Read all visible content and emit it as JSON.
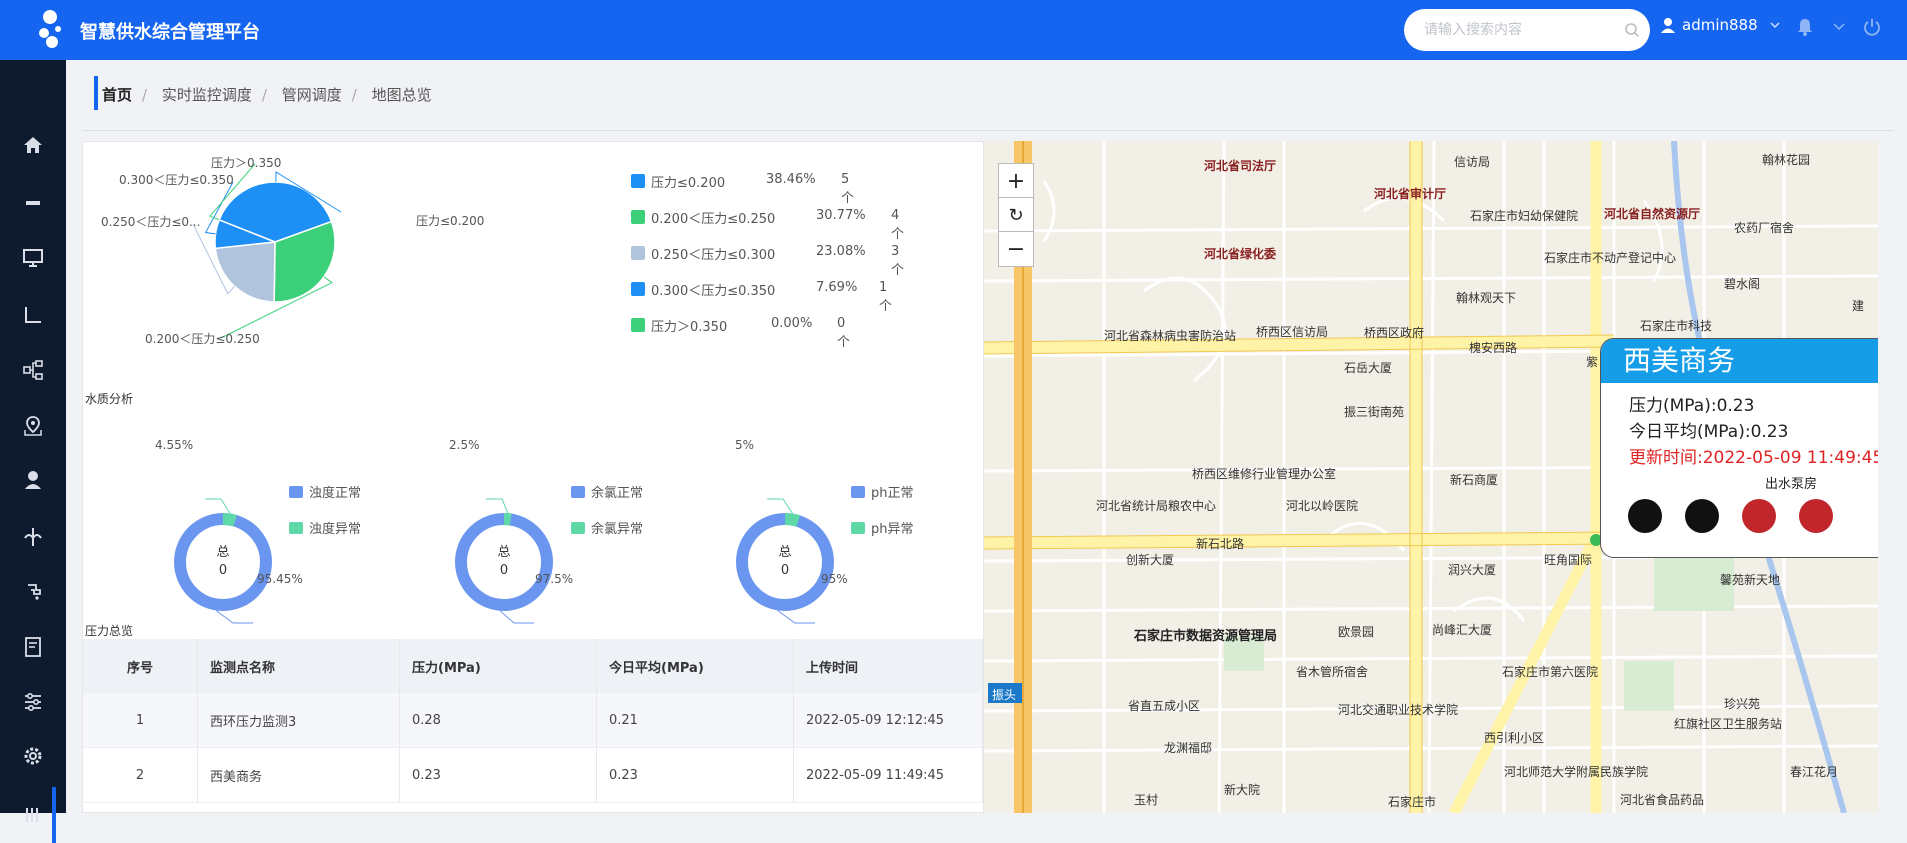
{
  "header": {
    "title": "智慧供水综合管理平台",
    "search_placeholder": "请输入搜索内容",
    "username": "admin888"
  },
  "sidebar": {
    "items": [
      "home-icon",
      "minus-icon",
      "monitor-icon",
      "corner-icon",
      "flow-chart-icon",
      "map-pin-icon",
      "user-service-icon",
      "network-icon",
      "tap-icon",
      "report-icon",
      "sliders-icon",
      "gear-icon",
      "menu-icon"
    ]
  },
  "breadcrumb": [
    "首页",
    "实时监控调度",
    "管网调度",
    "地图总览"
  ],
  "pressure_pie": {
    "chart_data": {
      "type": "pie",
      "categories": [
        "压力≤0.200",
        "0.200＜压力≤0.250",
        "0.250＜压力≤0.300",
        "0.300＜压力≤0.350",
        "压力＞0.350"
      ],
      "values": [
        38.46,
        30.77,
        23.08,
        7.69,
        0.0
      ],
      "counts": [
        5,
        4,
        3,
        1,
        0
      ],
      "colors": [
        "#1e90f5",
        "#3dd07a",
        "#b0c4de",
        "#1e90f5",
        "#3dd07a"
      ]
    },
    "slice_labels": [
      "压力≤0.200",
      "0.200＜压力≤0.250",
      "0.250＜压力≤0...",
      "0.300＜压力≤0.350",
      "压力＞0.350"
    ],
    "legend": [
      {
        "label": "压力≤0.200",
        "pct": "38.46%",
        "count": "5个",
        "color": "#1e90f5"
      },
      {
        "label": "0.200＜压力≤0.250",
        "pct": "30.77%",
        "count": "4个",
        "color": "#3dd07a"
      },
      {
        "label": "0.250＜压力≤0.300",
        "pct": "23.08%",
        "count": "3个",
        "color": "#b0c4de"
      },
      {
        "label": "0.300＜压力≤0.350",
        "pct": "7.69%",
        "count": "1个",
        "color": "#1e90f5"
      },
      {
        "label": "压力＞0.350",
        "pct": "0.00%",
        "count": "0个",
        "color": "#3dd07a"
      }
    ]
  },
  "water_quality": {
    "title": "水质分析",
    "center_top": "总",
    "center_value": "0",
    "donuts": [
      {
        "normal": "浊度正常",
        "abnormal": "浊度异常",
        "normal_pct": 95.45,
        "abnormal_pct": 4.55,
        "normal_label": "95.45%",
        "abnormal_label": "4.55%"
      },
      {
        "normal": "余氯正常",
        "abnormal": "余氯异常",
        "normal_pct": 97.5,
        "abnormal_pct": 2.5,
        "normal_label": "97.5%",
        "abnormal_label": "2.5%"
      },
      {
        "normal": "ph正常",
        "abnormal": "ph异常",
        "normal_pct": 95,
        "abnormal_pct": 5,
        "normal_label": "95%",
        "abnormal_label": "5%"
      }
    ],
    "colors": {
      "normal": "#6b96f0",
      "abnormal": "#5fd8a8"
    }
  },
  "pressure_overview": {
    "title": "压力总览",
    "columns": [
      "序号",
      "监测点名称",
      "压力(MPa)",
      "今日平均(MPa)",
      "上传时间"
    ],
    "rows": [
      [
        "1",
        "西环压力监测3",
        "0.28",
        "0.21",
        "2022-05-09 12:12:45"
      ],
      [
        "2",
        "西美商务",
        "0.23",
        "0.23",
        "2022-05-09 11:49:45"
      ]
    ]
  },
  "map": {
    "controls": {
      "zoom_in": "+",
      "reset": "↻",
      "zoom_out": "−"
    },
    "popup": {
      "title": "西美商务",
      "pressure": "压力(MPa):0.23",
      "avg": "今日平均(MPa):0.23",
      "updated": "更新时间:2022-05-09 11:49:45",
      "pump_label": "出水泵房",
      "pumps": [
        "#111111",
        "#111111",
        "#c0262b",
        "#c0262b"
      ]
    },
    "labels": [
      "信访局",
      "河北省司法厅",
      "河北省审计厅",
      "石家庄市妇幼保健院",
      "河北省自然资源厅",
      "河北省绿化委",
      "石家庄市不动产登记中心",
      "翰林观天下",
      "碧水阁",
      "河北省森林病虫害防治站",
      "桥西区信访局",
      "桥西区政府",
      "槐安西路",
      "石家庄市科技",
      "石岳大厦",
      "紫",
      "振三街南苑",
      "新石商厦",
      "桥西区维修行业管理办公室",
      "河北省统计局粮农中心",
      "河北以岭医院",
      "新石北路",
      "创新大厦",
      "润兴大厦",
      "旺角国际",
      "石家庄市数据资源管理局",
      "欧景园",
      "尚峰汇大厦",
      "省木管所宿舍",
      "石家庄市第六医院",
      "省直五成小区",
      "河北交通职业技术学院",
      "龙渊福邸",
      "西引利小区",
      "红旗社区卫生服务站",
      "珍兴苑",
      "振头",
      "河北师范大学附属民族学院",
      "新大院",
      "玉村",
      "石家庄市",
      "河北省食品药品",
      "春江花月",
      "馨苑新天地",
      "翰林花园",
      "农药厂宿舍",
      "建"
    ]
  }
}
